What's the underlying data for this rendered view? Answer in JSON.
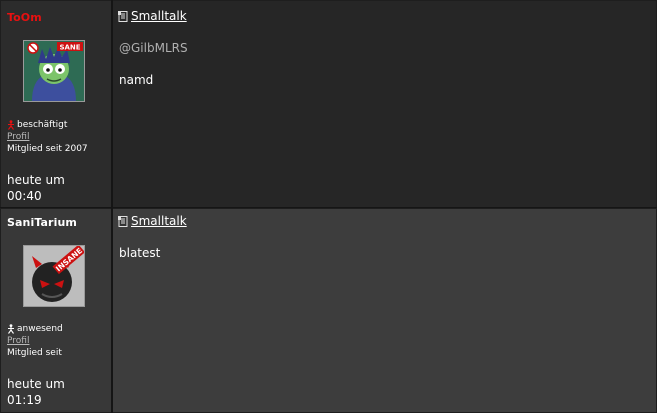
{
  "colors": {
    "username_post1": "#e81010",
    "username_post2": "#ffffff",
    "mention": "#b0b0b0",
    "text": "#ffffff"
  },
  "posts": [
    {
      "username": "ToOm",
      "avatar_badge": "SANE",
      "status_icon": "busy-person-icon",
      "status": "beschäftigt",
      "profile_link": "Profil",
      "member_since": "Mitglied seit 2007",
      "time_line1": "heute um",
      "time_line2": "00:40",
      "topic_icon": "document-icon",
      "topic": "Smalltalk",
      "message_lines": [
        "@GilbMLRS",
        "namd"
      ]
    },
    {
      "username": "SaniTarium",
      "avatar_badge": "INSANE",
      "status_icon": "present-person-icon",
      "status": "anwesend",
      "profile_link": "Profil",
      "member_since": "Mitglied seit",
      "time_line1": "heute um",
      "time_line2": "01:19",
      "topic_icon": "document-icon",
      "topic": "Smalltalk",
      "message_lines": [
        "blatest"
      ]
    }
  ]
}
